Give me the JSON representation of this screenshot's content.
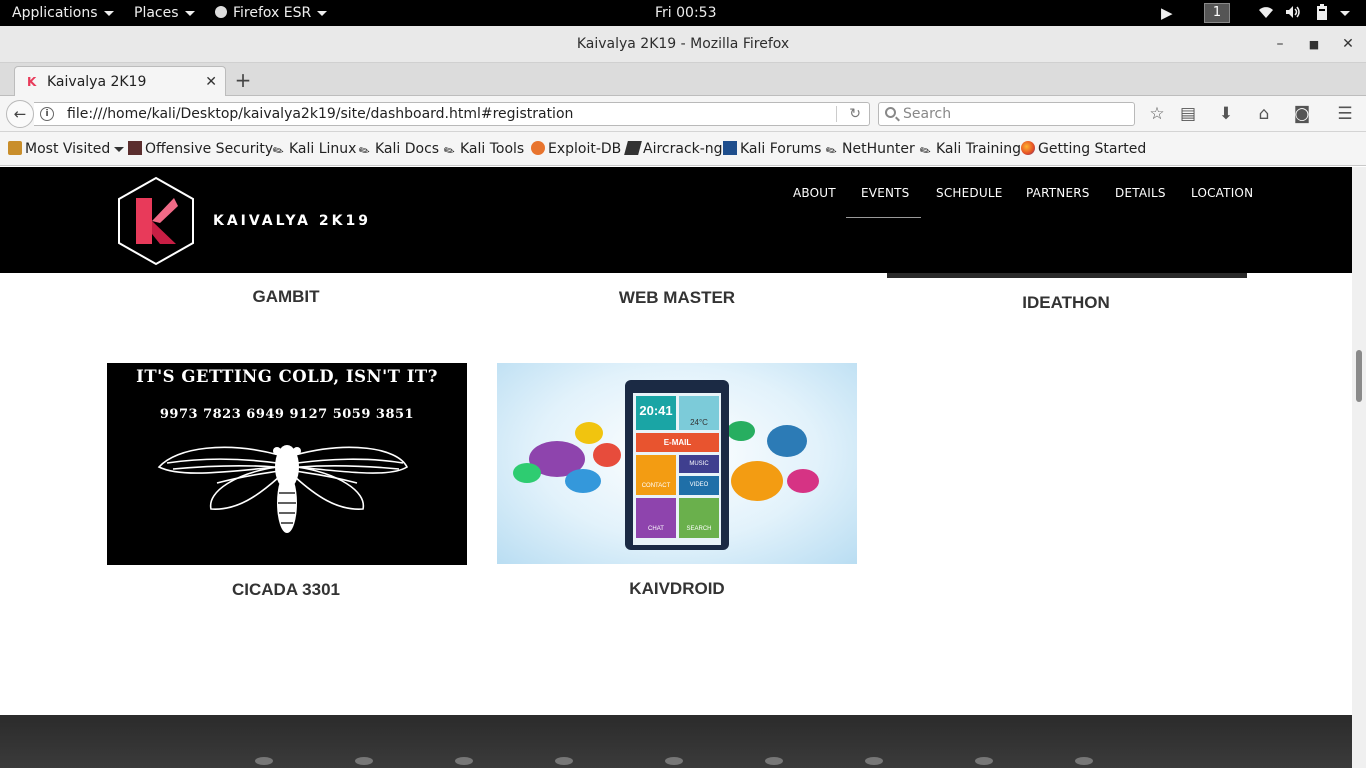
{
  "system_bar": {
    "applications": "Applications",
    "places": "Places",
    "app_name": "Firefox ESR",
    "clock": "Fri 00:53",
    "workspace": "1"
  },
  "window": {
    "title": "Kaivalya 2K19 - Mozilla Firefox"
  },
  "tabs": [
    {
      "label": "Kaivalya 2K19"
    }
  ],
  "navbar": {
    "url": "file:///home/kali/Desktop/kaivalya2k19/site/dashboard.html#registration",
    "search_placeholder": "Search"
  },
  "bookmarks": [
    {
      "label": "Most Visited",
      "icon": "folder-icon"
    },
    {
      "label": "Offensive Security",
      "icon": "offsec-icon"
    },
    {
      "label": "Kali Linux",
      "icon": "kali-dragon-icon"
    },
    {
      "label": "Kali Docs",
      "icon": "kali-dragon-icon"
    },
    {
      "label": "Kali Tools",
      "icon": "kali-dragon-icon"
    },
    {
      "label": "Exploit-DB",
      "icon": "exploitdb-icon"
    },
    {
      "label": "Aircrack-ng",
      "icon": "aircrack-icon"
    },
    {
      "label": "Kali Forums",
      "icon": "kali-forums-icon"
    },
    {
      "label": "NetHunter",
      "icon": "kali-dragon-icon"
    },
    {
      "label": "Kali Training",
      "icon": "kali-dragon-icon"
    },
    {
      "label": "Getting Started",
      "icon": "firefox-icon"
    }
  ],
  "site": {
    "brand": "KAIVALYA 2K19",
    "menu": [
      "ABOUT",
      "EVENTS",
      "SCHEDULE",
      "PARTNERS",
      "DETAILS",
      "LOCATION"
    ],
    "active_menu": "EVENTS",
    "accent_color": "#e83a5a",
    "events_row1": [
      "GAMBIT",
      "WEB MASTER",
      "IDEATHON"
    ],
    "events_row2": [
      "CICADA 3301",
      "KAIVDROID"
    ],
    "cicada_image": {
      "heading": "IT'S GETTING COLD, ISN'T IT?",
      "numbers": "9973 7823 6949 9127 5059 3851"
    },
    "kaivdroid_image": {
      "clock": "20:41",
      "temp": "24°C",
      "tiles": [
        "E-MAIL",
        "MUSIC",
        "CONTACT",
        "VIDEO",
        "CHAT",
        "SEARCH"
      ]
    }
  }
}
